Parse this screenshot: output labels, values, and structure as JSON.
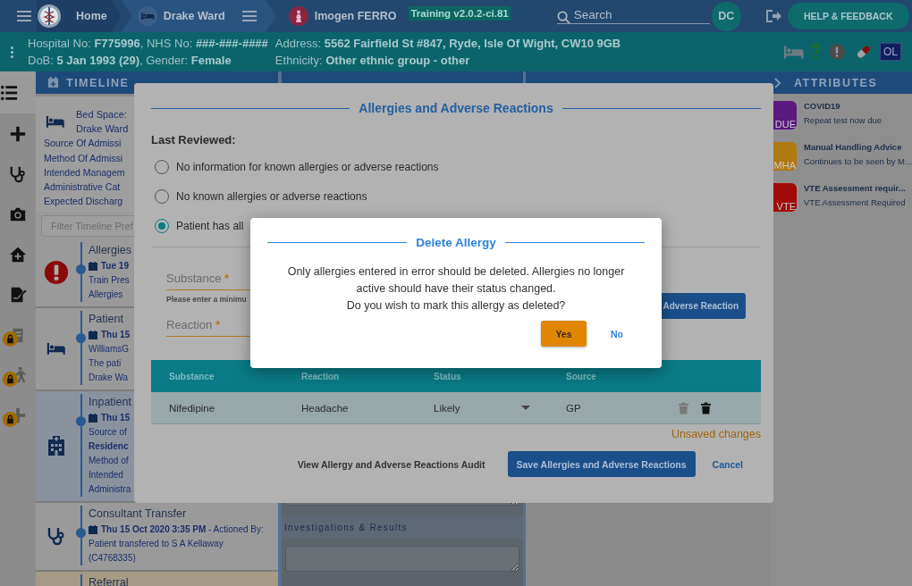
{
  "top_bar": {
    "breadcrumbs": [
      {
        "kind": "home",
        "label": "Home"
      },
      {
        "kind": "ward",
        "label": "Drake Ward"
      },
      {
        "kind": "patient",
        "label": "Imogen FERRO"
      }
    ],
    "version": "Training v2.0.2-ci.81",
    "search": {
      "placeholder": "Search"
    },
    "user_initials": "DC",
    "help_button": "HELP & FEEDBACK"
  },
  "patient_banner": {
    "left": [
      "Hospital No: **F775996**, NHS No: **###-###-####**",
      "DoB: **5 Jan 1993 (29)**, Gender: **Female**"
    ],
    "right": [
      "Address: **5562 Fairfield St #847, Ryde, Isle Of Wight, CW10 9GB**",
      "Ethnicity: **Other ethnic group - other**"
    ],
    "flags": [
      {
        "kind": "bed"
      },
      {
        "kind": "question"
      },
      {
        "kind": "alert"
      },
      {
        "kind": "pill"
      },
      {
        "kind": "initials",
        "label": "OL"
      }
    ]
  },
  "side_rail": [
    {
      "kind": "list",
      "selected": true,
      "locked": false
    },
    {
      "kind": "plus",
      "selected": false,
      "locked": false
    },
    {
      "kind": "stethoscope",
      "selected": false,
      "locked": false
    },
    {
      "kind": "camera",
      "selected": false,
      "locked": false
    },
    {
      "kind": "home",
      "selected": false,
      "locked": false
    },
    {
      "kind": "sign",
      "selected": false,
      "locked": false
    },
    {
      "kind": "clipboard",
      "selected": false,
      "locked": true
    },
    {
      "kind": "walk",
      "selected": false,
      "locked": true
    },
    {
      "kind": "cross",
      "selected": false,
      "locked": true
    }
  ],
  "timeline": {
    "title": "TIMELINE",
    "summary": {
      "bed": [
        "Bed Space:",
        "Drake Ward"
      ],
      "details": [
        "Source Of Admissi",
        "Method Of Admissi",
        "Intended Managem",
        "Administrative Cat",
        "Expected Discharg"
      ]
    },
    "filter": {
      "placeholder": "Filter Timeline Pref"
    },
    "entries": [
      {
        "kind": "allergy",
        "title": "Allergies",
        "date": "Tue 19",
        "lines": [
          "Train Pres",
          "Allergies"
        ]
      },
      {
        "kind": "bed",
        "title": "Patient",
        "date": "Thu 15",
        "lines": [
          "WilliamsG",
          "The pati",
          "Drake Wa"
        ]
      },
      {
        "kind": "inpatient",
        "title": "Inpatient",
        "date": "Thu 15",
        "lines": [
          "Source of",
          "**Residenc**",
          "Method of",
          "Intended",
          "Administra"
        ]
      },
      {
        "kind": "consultant",
        "title": "Consultant Transfer",
        "date": "Thu 15 Oct 2020 3:35 PM",
        "note": " - Actioned By:",
        "lines": [
          "Patient transfered to S A Kellaway",
          "(C4768335)"
        ]
      },
      {
        "kind": "referral",
        "title": "Referral"
      }
    ]
  },
  "clinical_panel": {
    "fields": [
      {
        "kind": "textarea"
      },
      {
        "kind": "label",
        "label": "Investigations & Results"
      },
      {
        "kind": "textarea"
      }
    ]
  },
  "attributes": {
    "title": "ATTRIBUTES",
    "items": [
      {
        "badge": "DUE",
        "title": "COVID19",
        "subtitle": "Repeat test now due",
        "color": "#5a1a80"
      },
      {
        "badge": "MHA",
        "title": "Manual Handling Advice",
        "subtitle": "Continues to be seen by M...",
        "color": "#b07a10"
      },
      {
        "badge": "VTE",
        "title": "VTE Assessment requir...",
        "subtitle": "VTE Assessment Required",
        "color": "#a00a0a"
      }
    ]
  },
  "allergy_dialog": {
    "title": "Allergies and Adverse Reactions",
    "last_reviewed": "Last Reviewed:",
    "options": [
      {
        "label": "No information for known allergies or adverse reactions",
        "selected": false
      },
      {
        "label": "No known allergies or adverse reactions",
        "selected": false
      },
      {
        "label": "Patient has all",
        "selected": true
      }
    ],
    "fields": [
      {
        "label": "Substance",
        "marker": "*",
        "helper": "Please enter a minimu"
      },
      {
        "label": "Reaction",
        "marker": "*"
      }
    ],
    "add_button": "Adverse Reaction",
    "columns": [
      "Substance",
      "Reaction",
      "Status",
      "Source"
    ],
    "rows": [
      {
        "substance": "Nifedipine",
        "reaction": "Headache",
        "status": "Likely",
        "source": "GP"
      }
    ],
    "unsaved": "Unsaved changes",
    "audit_link": "View Allergy and Adverse Reactions Audit",
    "save_button": "Save Allergies and Adverse Reactions",
    "cancel_button": "Cancel"
  },
  "delete_dialog": {
    "title": "Delete Allergy",
    "message": [
      "Only allergies entered in error should be deleted. Allergies no longer",
      "active should have their status changed.",
      "Do you wish to mark this allergy as deleted?"
    ],
    "yes_button": "Yes",
    "no_button": "No"
  }
}
